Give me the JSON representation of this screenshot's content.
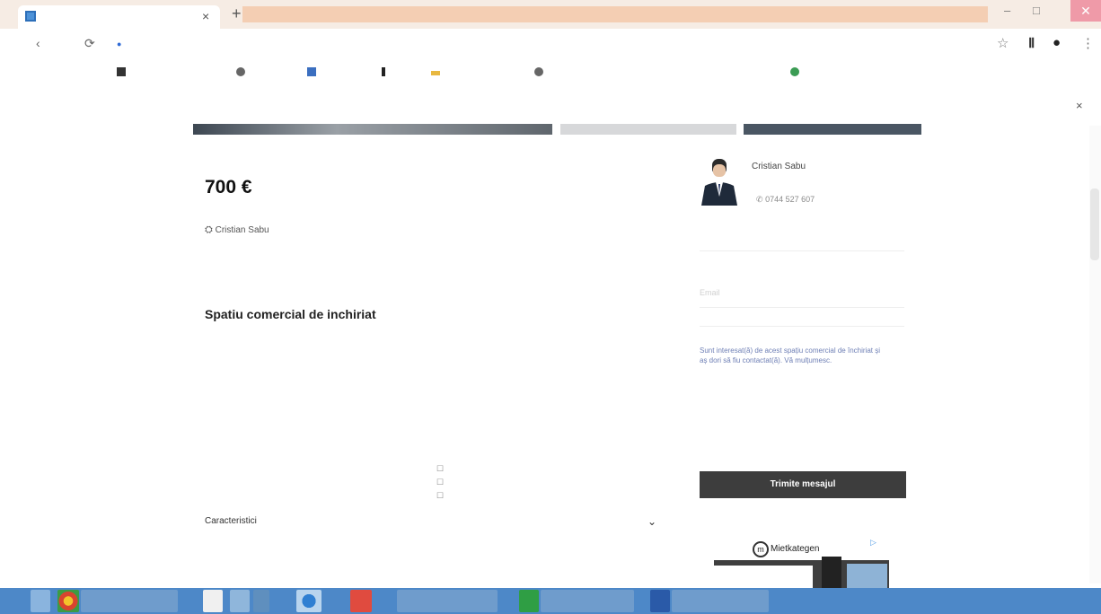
{
  "browser": {
    "tab_title": "",
    "tab_close": "×",
    "new_tab": "+",
    "url": "",
    "win_min": "–",
    "win_max": "□",
    "win_close": "✕",
    "back": "‹",
    "reload": "⟳",
    "bookmarks": [
      {
        "label": "",
        "color": "#333333"
      },
      {
        "label": "",
        "color": "#666666"
      },
      {
        "label": "",
        "color": "#3b6fc0"
      },
      {
        "label": "",
        "color": "#222222"
      },
      {
        "label": "",
        "color": "#e8b840"
      },
      {
        "label": "",
        "color": "#666666"
      },
      {
        "label": "",
        "color": "#3b9c54"
      }
    ],
    "info_bar_message": "",
    "info_bar_action": "",
    "info_close": "×"
  },
  "listing": {
    "breadcrumb": "",
    "price": "700 €",
    "agent_link": "Cristian Sabu",
    "title": "Spatiu comercial de inchiriat",
    "properties": [
      {
        "label": "",
        "value": ""
      },
      {
        "label": "",
        "value": ""
      },
      {
        "label": "",
        "value": ""
      },
      {
        "label": "",
        "value": ""
      },
      {
        "label": "",
        "value": ""
      },
      {
        "label": "",
        "value": ""
      },
      {
        "label": "",
        "value": ""
      },
      {
        "label": "",
        "value": ""
      }
    ],
    "characteristics_label": "Caracteristici",
    "chevron": "⌄"
  },
  "contact": {
    "agent_name": "Cristian Sabu",
    "agent_phone": "0744 527 607",
    "name_placeholder": "",
    "email_placeholder": "Email",
    "phone_placeholder": "",
    "message": "Sunt interesat(ă) de acest spațiu comercial de închiriat și aș dori să fiu contactat(ă). Vă mulțumesc.",
    "terms_line": "",
    "terms_link": "",
    "send_button": "Trimite mesajul"
  },
  "ad": {
    "brand": "Mietkategen",
    "logo_letter": "m"
  },
  "taskbar": {
    "items": [
      {
        "label": "",
        "color": "#e9f1f9"
      },
      {
        "label": "",
        "color": "#2f9e44"
      },
      {
        "label": "",
        "color": "#2a5aa8"
      }
    ],
    "tray": "",
    "clock": ""
  }
}
